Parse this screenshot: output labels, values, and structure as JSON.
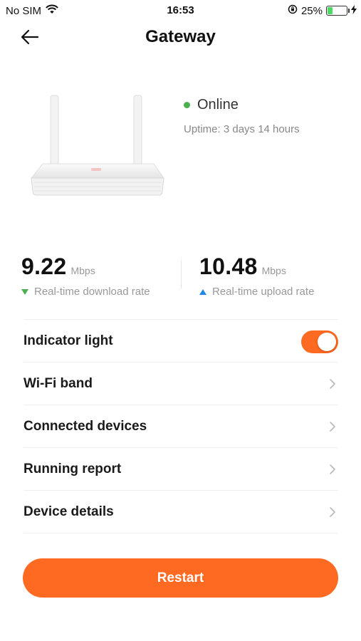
{
  "status_bar": {
    "carrier": "No SIM",
    "time": "16:53",
    "battery_percent": "25%",
    "battery_level": 0.25
  },
  "nav": {
    "title": "Gateway"
  },
  "device": {
    "status": "Online",
    "status_color": "#4caf50",
    "uptime": "Uptime: 3 days 14 hours"
  },
  "rates": {
    "download": {
      "value": "9.22",
      "unit": "Mbps",
      "label": "Real-time download rate",
      "icon": "triangle-down-icon",
      "color": "#4caf50"
    },
    "upload": {
      "value": "10.48",
      "unit": "Mbps",
      "label": "Real-time upload rate",
      "icon": "triangle-up-icon",
      "color": "#1e88e5"
    }
  },
  "settings": {
    "items": [
      {
        "label": "Indicator light",
        "control": "toggle",
        "on": true
      },
      {
        "label": "Wi-Fi band",
        "control": "chevron"
      },
      {
        "label": "Connected devices",
        "control": "chevron"
      },
      {
        "label": "Running report",
        "control": "chevron"
      },
      {
        "label": "Device details",
        "control": "chevron"
      }
    ]
  },
  "actions": {
    "restart_label": "Restart"
  },
  "colors": {
    "accent": "#ff6a22"
  }
}
